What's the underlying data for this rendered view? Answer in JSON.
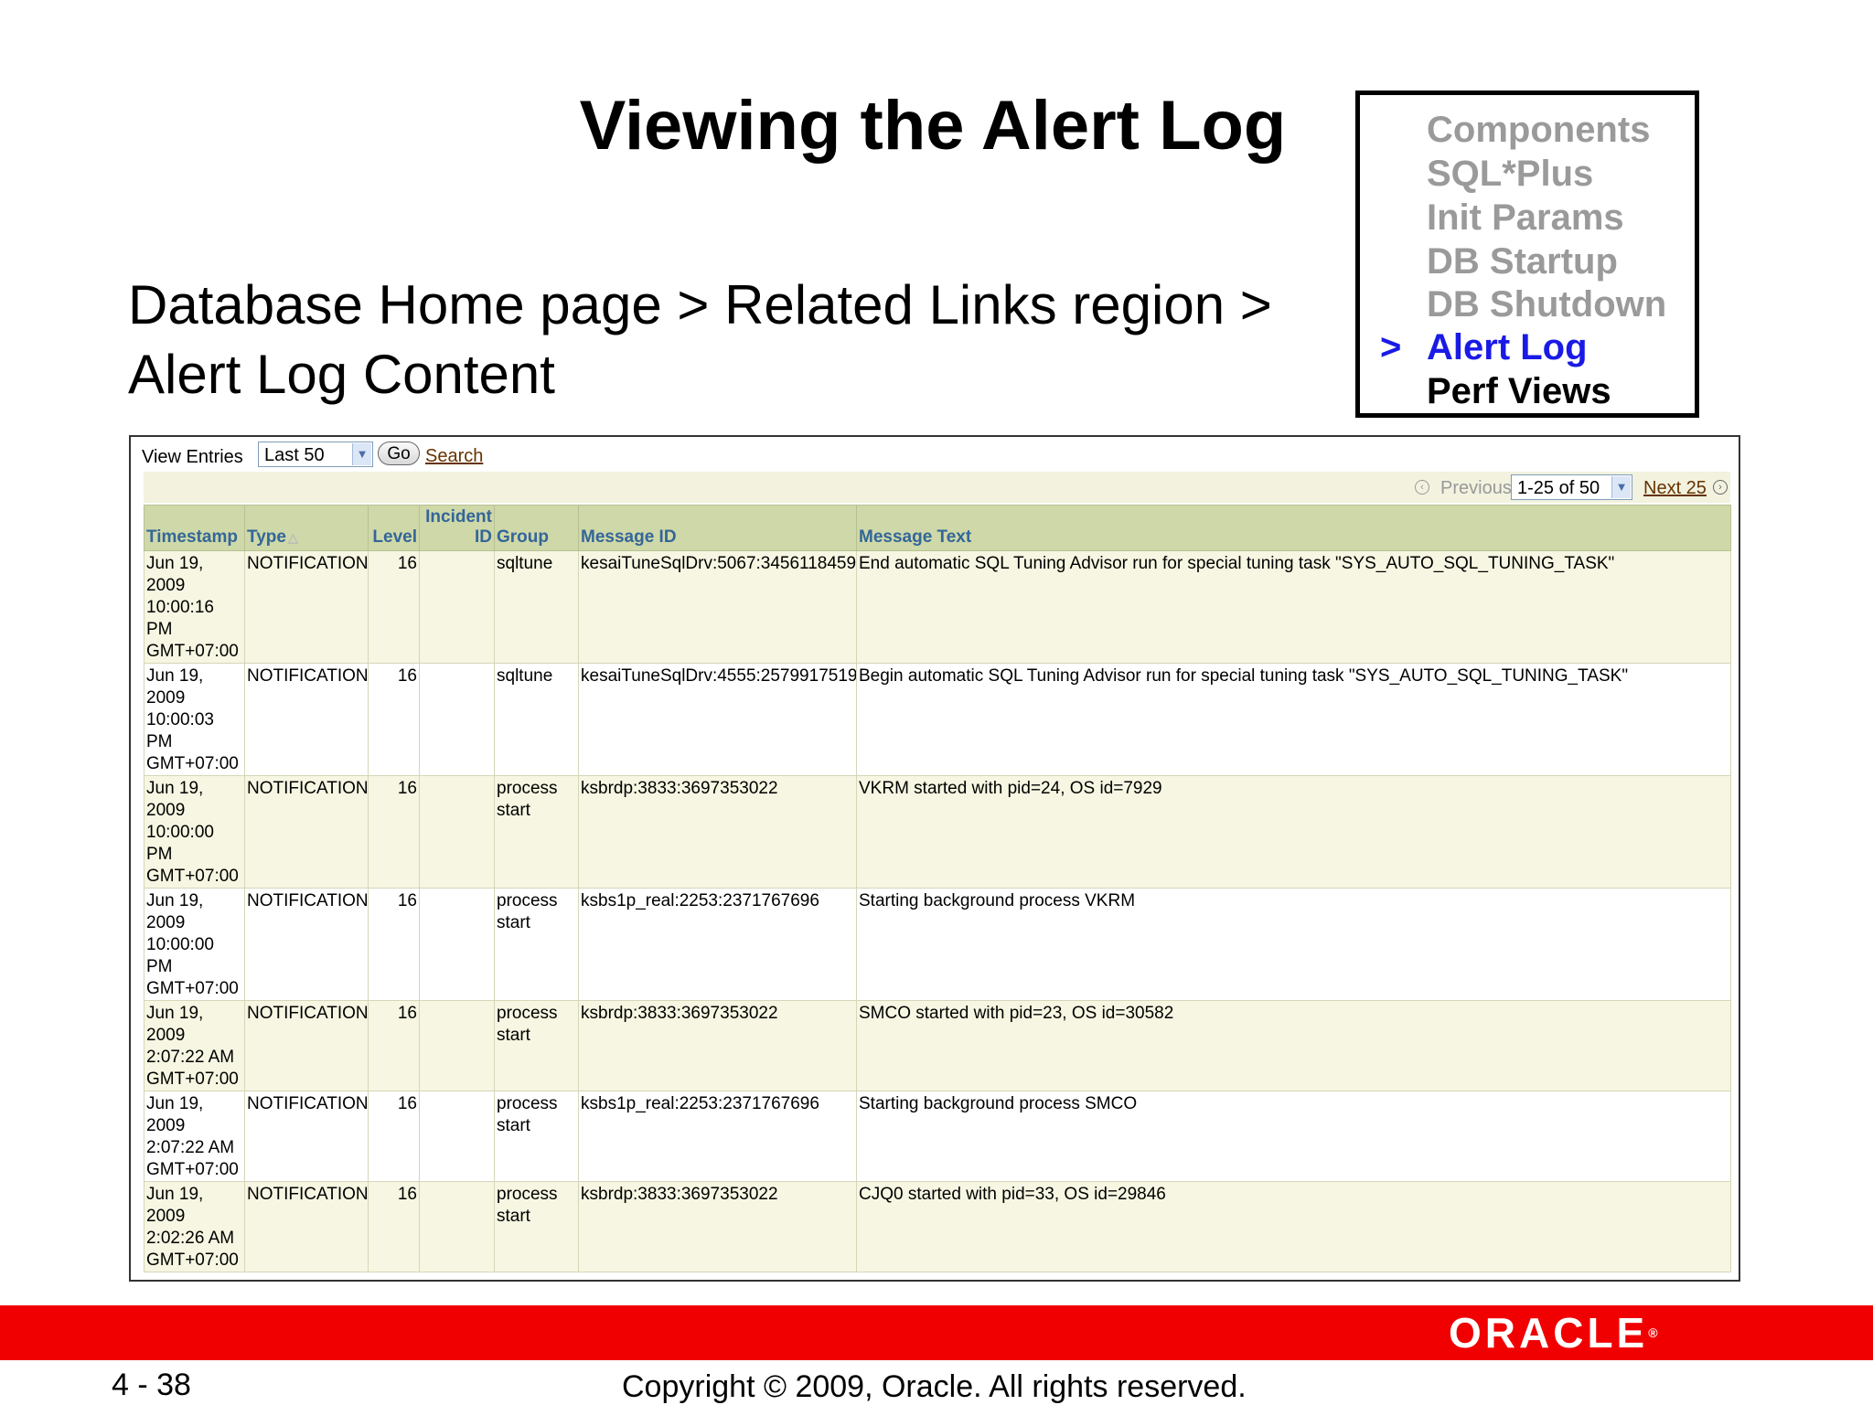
{
  "slide": {
    "title": "Viewing the Alert Log",
    "breadcrumb_line1": "Database Home page > Related Links region >",
    "breadcrumb_line2": "Alert Log Content",
    "topics": [
      "Components",
      "SQL*Plus",
      "Init Params",
      "DB Startup",
      "DB Shutdown",
      "Alert Log",
      "Perf Views"
    ],
    "active_topic": "Alert Log",
    "topic_marker": ">",
    "page_number": "4 - 38",
    "copyright": "Copyright © 2009, Oracle. All rights reserved.",
    "logo_text": "ORACLE"
  },
  "toolbar": {
    "view_entries_label": "View Entries",
    "view_entries_value": "Last 50",
    "go_label": "Go",
    "search_label": "Search"
  },
  "pagination": {
    "previous_label": "Previous",
    "range_value": "1-25 of 50",
    "next_label": "Next 25"
  },
  "table": {
    "headers": {
      "timestamp": "Timestamp",
      "type": "Type",
      "level": "Level",
      "incident_line1": "Incident",
      "incident_line2": "ID",
      "group": "Group",
      "message_id": "Message ID",
      "message_text": "Message Text"
    },
    "rows": [
      {
        "timestamp": "Jun 19, 2009 10:00:16 PM GMT+07:00",
        "type": "NOTIFICATION",
        "level": "16",
        "incident_id": "",
        "group": "sqltune",
        "message_id": "kesaiTuneSqlDrv:5067:3456118459",
        "message_text": "End automatic SQL Tuning Advisor run for special tuning task  \"SYS_AUTO_SQL_TUNING_TASK\""
      },
      {
        "timestamp": "Jun 19, 2009 10:00:03 PM GMT+07:00",
        "type": "NOTIFICATION",
        "level": "16",
        "incident_id": "",
        "group": "sqltune",
        "message_id": "kesaiTuneSqlDrv:4555:2579917519",
        "message_text": "Begin automatic SQL Tuning Advisor run for special tuning task  \"SYS_AUTO_SQL_TUNING_TASK\""
      },
      {
        "timestamp": "Jun 19, 2009 10:00:00 PM GMT+07:00",
        "type": "NOTIFICATION",
        "level": "16",
        "incident_id": "",
        "group": "process start",
        "message_id": "ksbrdp:3833:3697353022",
        "message_text": "VKRM started with pid=24, OS id=7929"
      },
      {
        "timestamp": "Jun 19, 2009 10:00:00 PM GMT+07:00",
        "type": "NOTIFICATION",
        "level": "16",
        "incident_id": "",
        "group": "process start",
        "message_id": "ksbs1p_real:2253:2371767696",
        "message_text": "Starting background process VKRM"
      },
      {
        "timestamp": "Jun 19, 2009 2:07:22 AM GMT+07:00",
        "type": "NOTIFICATION",
        "level": "16",
        "incident_id": "",
        "group": "process start",
        "message_id": "ksbrdp:3833:3697353022",
        "message_text": "SMCO started with pid=23, OS id=30582"
      },
      {
        "timestamp": "Jun 19, 2009 2:07:22 AM GMT+07:00",
        "type": "NOTIFICATION",
        "level": "16",
        "incident_id": "",
        "group": "process start",
        "message_id": "ksbs1p_real:2253:2371767696",
        "message_text": "Starting background process SMCO"
      },
      {
        "timestamp": "Jun 19, 2009 2:02:26 AM GMT+07:00",
        "type": "NOTIFICATION",
        "level": "16",
        "incident_id": "",
        "group": "process start",
        "message_id": "ksbrdp:3833:3697353022",
        "message_text": "CJQ0 started with pid=33, OS id=29846"
      }
    ]
  }
}
